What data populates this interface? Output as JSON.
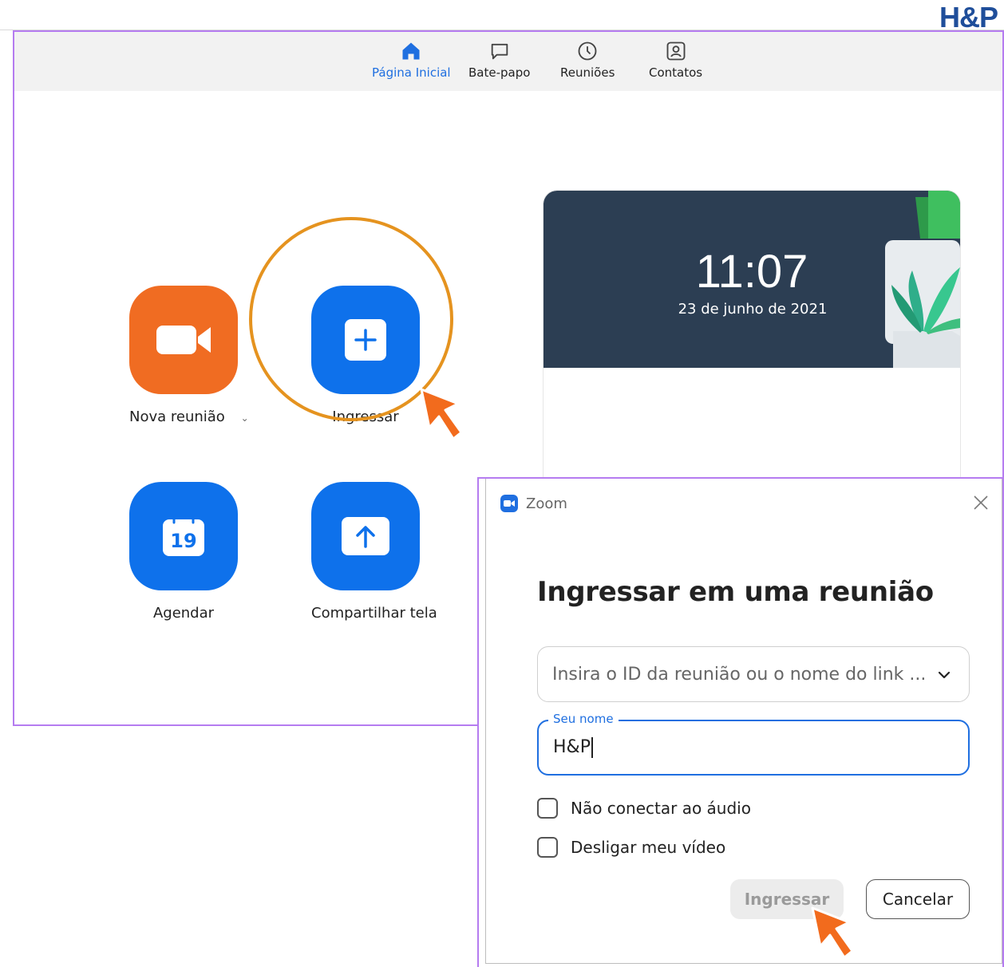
{
  "brand": {
    "logo_text": "H&P"
  },
  "nav": {
    "tabs": [
      {
        "label": "Página Inicial",
        "icon": "home-icon",
        "active": true
      },
      {
        "label": "Bate-papo",
        "icon": "chat-icon",
        "active": false
      },
      {
        "label": "Reuniões",
        "icon": "clock-icon",
        "active": false
      },
      {
        "label": "Contatos",
        "icon": "contacts-icon",
        "active": false
      }
    ]
  },
  "actions": {
    "new_meeting": "Nova reunião",
    "join": "Ingressar",
    "schedule": "Agendar",
    "schedule_day": "19",
    "share_screen": "Compartilhar tela"
  },
  "clock": {
    "time": "11:07",
    "date": "23 de junho de 2021"
  },
  "dialog": {
    "app_name": "Zoom",
    "heading": "Ingressar em uma reunião",
    "meeting_id_placeholder": "Insira o ID da reunião ou o nome do link ...",
    "name_label": "Seu nome",
    "name_value": "H&P",
    "options": [
      {
        "label": "Não conectar ao áudio",
        "checked": false
      },
      {
        "label": "Desligar meu vídeo",
        "checked": false
      }
    ],
    "join_button": "Ingressar",
    "cancel_button": "Cancelar"
  },
  "colors": {
    "accent_blue": "#0e71eb",
    "new_meeting_orange": "#f06c22",
    "highlight_ring": "#e5931f",
    "annotation_purple": "#b57cf0",
    "pointer_orange": "#f26b1d"
  }
}
